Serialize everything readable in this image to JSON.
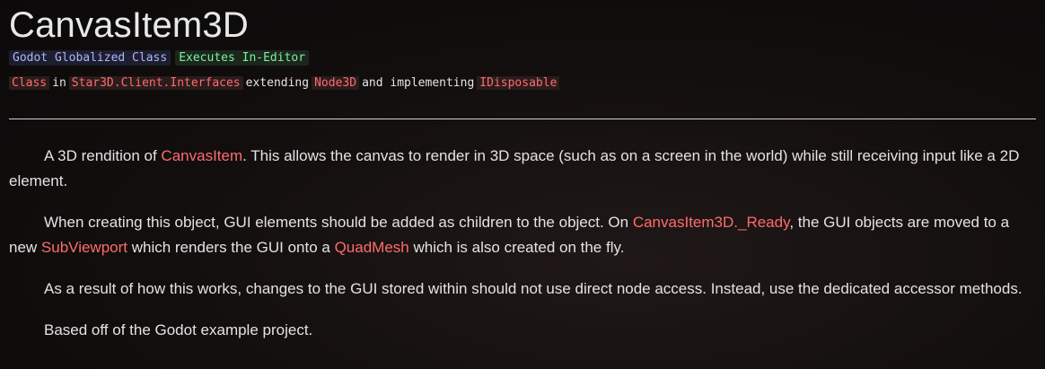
{
  "title": "CanvasItem3D",
  "badges": {
    "godot": "Godot Globalized Class",
    "editor": "Executes In-Editor"
  },
  "signature": {
    "kind": "Class",
    "in_word": "in",
    "namespace": "Star3D.Client.Interfaces",
    "extending_word": "extending",
    "base": "Node3D",
    "implementing_word": "and implementing",
    "interface": "IDisposable"
  },
  "paragraphs": {
    "p1": {
      "a": "A 3D rendition of ",
      "link1": "CanvasItem",
      "b": ". This allows the canvas to render in 3D space (such as on a screen in the world) while still receiving input like a 2D element."
    },
    "p2": {
      "a": "When creating this object, GUI elements should be added as children to the object. On ",
      "link1": "CanvasItem3D._Ready",
      "b": ", the GUI objects are moved to a new ",
      "link2": "SubViewport",
      "c": " which renders the GUI onto a ",
      "link3": "QuadMesh",
      "d": " which is also created on the fly."
    },
    "p3": {
      "a": "As a result of how this works, changes to the GUI stored within should not use direct node access. Instead, use the dedicated accessor methods."
    },
    "p4": {
      "a": "Based off of the Godot example project."
    }
  },
  "colors": {
    "background": "#0e0b0b",
    "text": "#e3e3e3",
    "link": "#ff6b6b",
    "badge_godot": "#b0b5ff",
    "badge_editor": "#7cf29a"
  }
}
